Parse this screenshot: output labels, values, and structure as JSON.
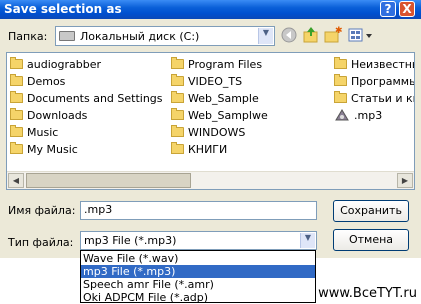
{
  "window": {
    "title": "Save selection as",
    "help_button": "?",
    "close_button": "X"
  },
  "location": {
    "label": "Папка:",
    "value": "Локальный диск (C:)"
  },
  "files": {
    "column1": [
      "audiograbber",
      "Demos",
      "Documents and Settings",
      "Downloads",
      "Music",
      "My Music"
    ],
    "column2": [
      "Program Files",
      "VIDEO_TS",
      "Web_Sample",
      "Web_Samplwe",
      "WINDOWS",
      "КНИГИ"
    ],
    "column3": [
      "Неизвестны",
      "Программы",
      "Статьи и кн",
      ".mp3"
    ]
  },
  "filename": {
    "label": "Имя файла:",
    "value": ".mp3"
  },
  "filetype": {
    "label": "Тип файла:",
    "value": "mp3 File (*.mp3)",
    "options": [
      "Wave File (*.wav)",
      "mp3 File (*.mp3)",
      "Speech amr File (*.amr)",
      "Oki ADPCM File (*.adp)"
    ],
    "selected_index": 1
  },
  "buttons": {
    "save": "Сохранить",
    "cancel": "Отмена"
  },
  "watermark": "www.BceTYT.ru",
  "colors": {
    "titlebar": "#0054e3",
    "selection": "#316ac5",
    "dialog_bg": "#ece9d8"
  }
}
